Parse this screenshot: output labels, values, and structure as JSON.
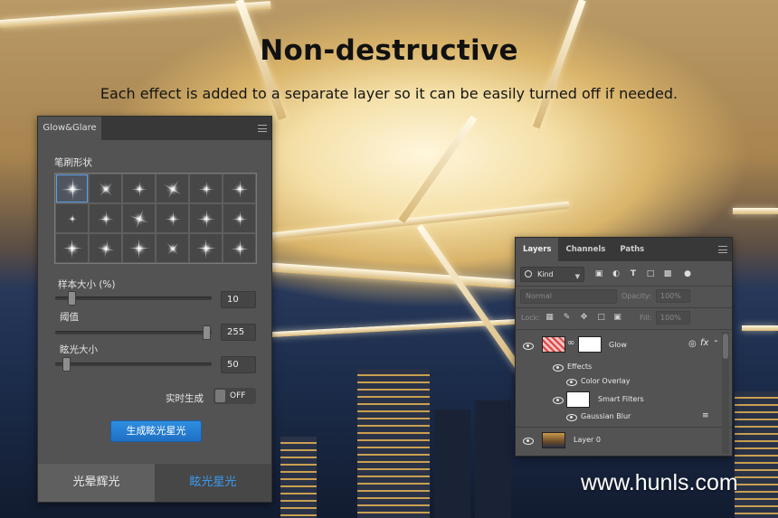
{
  "headline": {
    "title": "Non-destructive",
    "subtitle": "Each effect is added to a separate layer so it can be easily turned off if needed."
  },
  "watermark": "www.hunls.com",
  "glow_panel": {
    "tab_title": "Glow&Glare",
    "brush_shape_label": "笔刷形状",
    "brush_count": 18,
    "selected_brush_index": 0,
    "sliders": [
      {
        "label": "样本大小 (%)",
        "value": "10",
        "level": 0.1
      },
      {
        "label": "阈值",
        "value": "255",
        "level": 1.0
      },
      {
        "label": "眩光大小",
        "value": "50",
        "level": 0.05
      }
    ],
    "realtime_label": "实时生成",
    "realtime_toggle": "OFF",
    "generate_button": "生成眩光星光",
    "bottom_tabs": [
      "光晕辉光",
      "眩光星光"
    ],
    "accent_color": "#2f8fe0"
  },
  "layers_panel": {
    "tabs": [
      "Layers",
      "Channels",
      "Paths"
    ],
    "filter_kind": "Kind",
    "blend_mode": "Normal",
    "opacity_label": "Opacity:",
    "opacity_value": "100%",
    "lock_label": "Lock:",
    "fill_label": "Fill:",
    "fill_value": "100%",
    "layers": [
      {
        "name": "Glow",
        "fx": "fx"
      },
      {
        "name": "Effects"
      },
      {
        "name": "Color Overlay"
      },
      {
        "name": "Smart Filters"
      },
      {
        "name": "Gaussian Blur"
      },
      {
        "name": "Layer 0"
      }
    ]
  }
}
